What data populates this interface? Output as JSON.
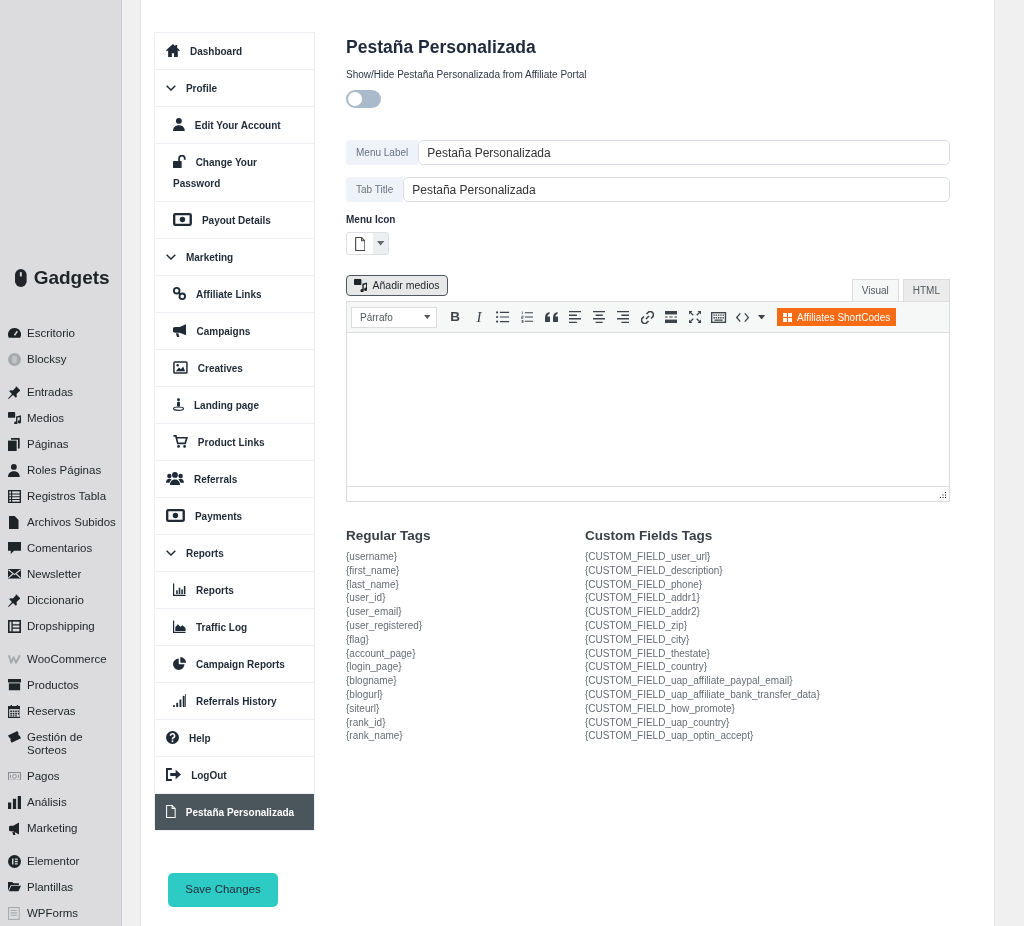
{
  "admin_menu": {
    "logo": "Gadgets",
    "groups": [
      {
        "items": [
          {
            "label": "Escritorio",
            "selected": false
          },
          {
            "label": "Blocksy",
            "selected": false
          }
        ]
      },
      {
        "items": [
          {
            "label": "Entradas",
            "selected": false
          },
          {
            "label": "Medios",
            "selected": false
          },
          {
            "label": "Páginas",
            "selected": false
          },
          {
            "label": "Roles Páginas",
            "selected": false
          },
          {
            "label": "Registros Tabla",
            "selected": false
          },
          {
            "label": "Archivos Subidos",
            "selected": false
          },
          {
            "label": "Comentarios",
            "selected": false
          },
          {
            "label": "Newsletter",
            "selected": false
          },
          {
            "label": "Diccionario",
            "selected": false
          },
          {
            "label": "Dropshipping",
            "selected": false
          }
        ]
      },
      {
        "items": [
          {
            "label": "WooCommerce",
            "selected": false
          },
          {
            "label": "Productos",
            "selected": false
          },
          {
            "label": "Reservas",
            "selected": false
          },
          {
            "label": "Gestión de Sorteos",
            "selected": false
          },
          {
            "label": "Pagos",
            "selected": false
          },
          {
            "label": "Análisis",
            "selected": false
          },
          {
            "label": "Marketing",
            "selected": false
          }
        ]
      },
      {
        "items": [
          {
            "label": "Elementor",
            "selected": false
          },
          {
            "label": "Plantillas",
            "selected": false
          },
          {
            "label": "WPForms",
            "selected": false
          }
        ]
      }
    ]
  },
  "portal_nav": [
    {
      "label": "Dashboard",
      "selected": false
    },
    {
      "label": "Profile",
      "expanded": true,
      "children": [
        {
          "label": "Edit Your Account",
          "selected": false
        },
        {
          "label": "Change Your Password",
          "selected": false
        },
        {
          "label": "Payout Details",
          "selected": false
        }
      ]
    },
    {
      "label": "Marketing",
      "expanded": true,
      "children": [
        {
          "label": "Affiliate Links",
          "selected": false
        },
        {
          "label": "Campaigns",
          "selected": false
        },
        {
          "label": "Creatives",
          "selected": false
        },
        {
          "label": "Landing page",
          "selected": false
        },
        {
          "label": "Product Links",
          "selected": false
        }
      ]
    },
    {
      "label": "Referrals",
      "selected": false
    },
    {
      "label": "Payments",
      "selected": false
    },
    {
      "label": "Reports",
      "expanded": true,
      "children": [
        {
          "label": "Reports",
          "selected": false
        },
        {
          "label": "Traffic Log",
          "selected": false
        },
        {
          "label": "Campaign Reports",
          "selected": false
        },
        {
          "label": "Referrals History",
          "selected": false
        }
      ]
    },
    {
      "label": "Help",
      "selected": false
    },
    {
      "label": "LogOut",
      "selected": false
    },
    {
      "label": "Pestaña Personalizada",
      "selected": true
    }
  ],
  "save_button": "Save Changes",
  "content": {
    "title": "Pestaña Personalizada",
    "toggle": {
      "label": "Show/Hide Pestaña Personalizada from Affiliate Portal",
      "on": false
    },
    "fields": [
      {
        "label": "Menu Label",
        "value": "Pestaña Personalizada"
      },
      {
        "label": "Tab Title",
        "value": "Pestaña Personalizada"
      }
    ],
    "menu_icon_label": "Menu Icon",
    "editor": {
      "media_button": "Añadir medios",
      "tabs": [
        {
          "label": "Visual",
          "selected": true
        },
        {
          "label": "HTML",
          "selected": false
        }
      ],
      "format_select": "Párrafo",
      "format_buttons": [
        "B",
        "I"
      ],
      "shortcodes_button": "Affiliates ShortCodes"
    },
    "tag_lists": [
      {
        "title": "Regular Tags",
        "tags": [
          "{username}",
          "{first_name}",
          "{last_name}",
          "{user_id}",
          "{user_email}",
          "{user_registered}",
          "{flag}",
          "{account_page}",
          "{login_page}",
          "{blogname}",
          "{blogurl}",
          "{siteurl}",
          "{rank_id}",
          "{rank_name}"
        ]
      },
      {
        "title": "Custom Fields Tags",
        "tags": [
          "{CUSTOM_FIELD_user_url}",
          "{CUSTOM_FIELD_description}",
          "{CUSTOM_FIELD_phone}",
          "{CUSTOM_FIELD_addr1}",
          "{CUSTOM_FIELD_addr2}",
          "{CUSTOM_FIELD_zip}",
          "{CUSTOM_FIELD_city}",
          "{CUSTOM_FIELD_thestate}",
          "{CUSTOM_FIELD_country}",
          "{CUSTOM_FIELD_uap_affiliate_paypal_email}",
          "{CUSTOM_FIELD_uap_affiliate_bank_transfer_data}",
          "{CUSTOM_FIELD_how_promote}",
          "{CUSTOM_FIELD_uap_country}",
          "{CUSTOM_FIELD_uap_optin_accept}"
        ]
      }
    ]
  }
}
